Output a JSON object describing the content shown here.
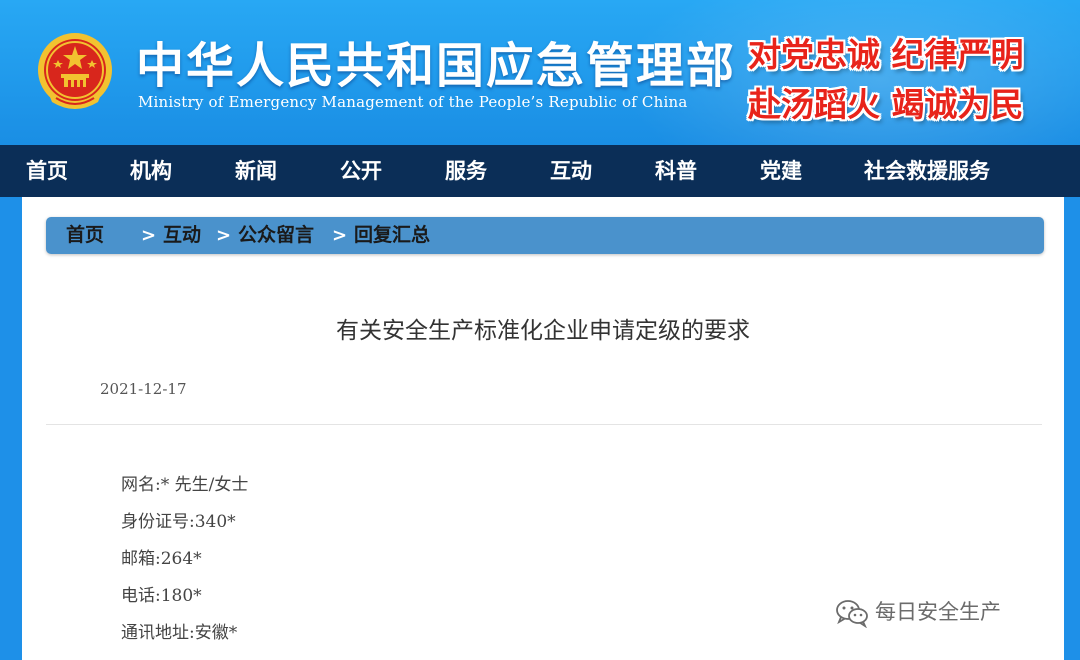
{
  "header": {
    "title_cn": "中华人民共和国应急管理部",
    "title_en": "Ministry of Emergency Management of the People’s Republic of China",
    "slogan_line1": "对党忠诚 纪律严明",
    "slogan_line2": "赴汤蹈火 竭诚为民",
    "emblem_icon": "national-emblem-icon",
    "colors": {
      "header_blue": "#1e90e8",
      "slogan_red": "#e8231a"
    }
  },
  "nav": {
    "items": [
      {
        "label": "首页"
      },
      {
        "label": "机构"
      },
      {
        "label": "新闻"
      },
      {
        "label": "公开"
      },
      {
        "label": "服务"
      },
      {
        "label": "互动"
      },
      {
        "label": "科普"
      },
      {
        "label": "党建"
      },
      {
        "label": "社会救援服务"
      }
    ],
    "colors": {
      "background": "#0b2e57"
    }
  },
  "breadcrumb": {
    "items": [
      {
        "label": "首页"
      },
      {
        "label": "互动"
      },
      {
        "label": "公众留言"
      },
      {
        "label": "回复汇总"
      }
    ],
    "separator": ">",
    "colors": {
      "background": "#4a92cc"
    }
  },
  "article": {
    "title": "有关安全生产标准化企业申请定级的要求",
    "date": "2021-12-17",
    "fields": [
      "网名:* 先生/女士",
      "身份证号:340*",
      "邮箱:264*",
      "电话:180*",
      "通讯地址:安徽*"
    ]
  },
  "watermark": {
    "text": "每日安全生产",
    "icon": "wechat-icon"
  }
}
